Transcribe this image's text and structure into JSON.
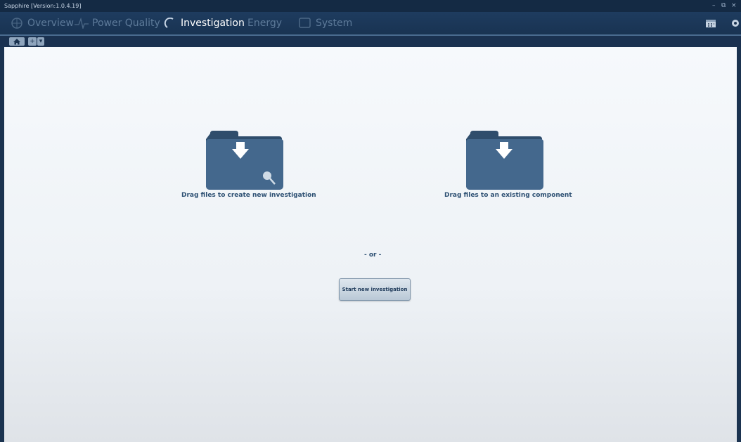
{
  "window": {
    "title": "Sapphire [Version:1.0.4.19]",
    "controls": [
      "–",
      "⧉",
      "×"
    ]
  },
  "nav": {
    "tabs": [
      {
        "label": "Overview",
        "icon": "globe-icon",
        "active": false
      },
      {
        "label": "Power Quality",
        "icon": "waveform-icon",
        "active": false
      },
      {
        "label": "Investigation",
        "icon": "magnifier-icon",
        "active": true
      },
      {
        "label": "Energy",
        "icon": "energy-icon",
        "active": false
      },
      {
        "label": "System",
        "icon": "monitor-icon",
        "active": false
      }
    ],
    "right_icons": [
      "calendar-icon",
      "gear-icon"
    ]
  },
  "toolbar": {
    "home_icon": "home-icon",
    "add_label": "+",
    "dropdown_label": "▾"
  },
  "main": {
    "drop_new_label": "Drag files to create new investigation",
    "drop_existing_label": "Drag files to an existing component",
    "or_label": "- or -",
    "start_button_label": "Start new investigation"
  },
  "colors": {
    "accent": "#1b3350",
    "folder": "#3d5f82",
    "label": "#2c4f72"
  }
}
